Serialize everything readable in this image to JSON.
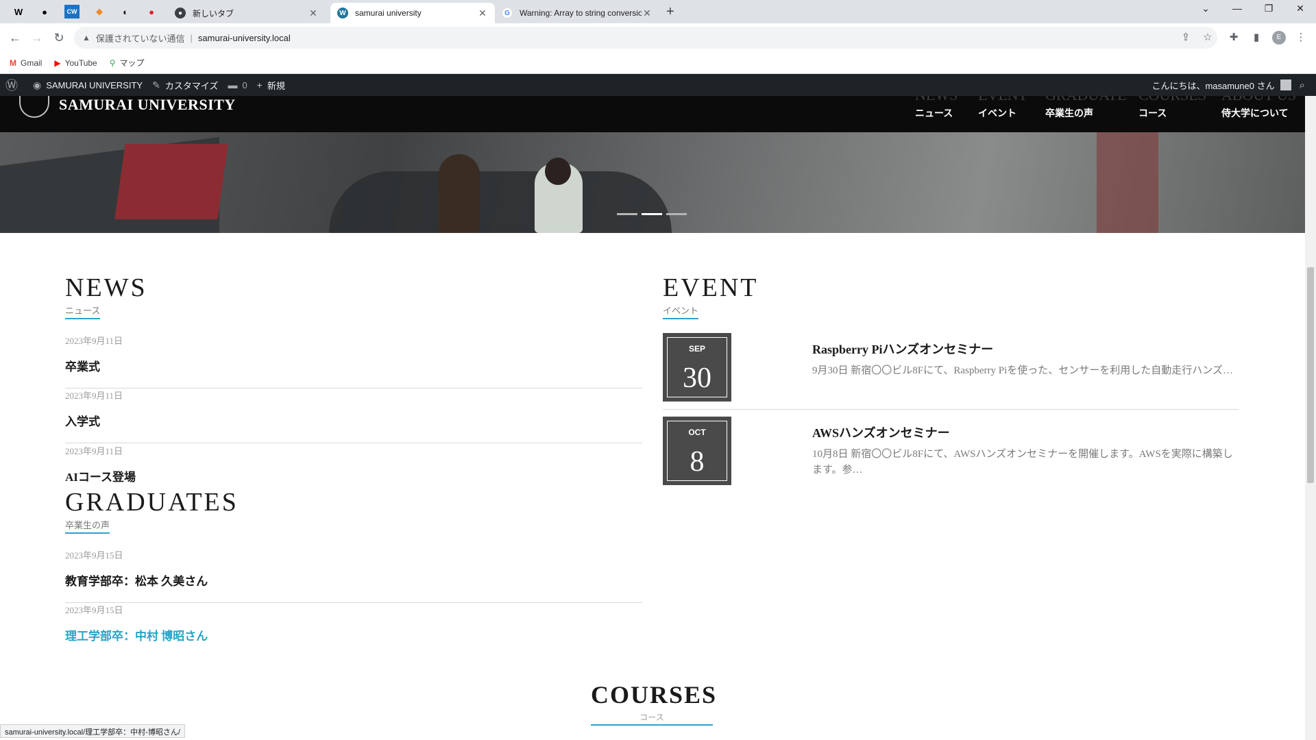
{
  "browser": {
    "tabs": [
      {
        "title": "新しいタブ",
        "favicon": "github-icon"
      },
      {
        "title": "samurai university",
        "favicon": "wordpress-icon",
        "active": true
      },
      {
        "title": "Warning: Array to string conversio",
        "favicon": "google-icon"
      }
    ],
    "address": {
      "security": "保護されていない通信",
      "url": "samurai-university.local"
    },
    "bookmarks": [
      {
        "label": "Gmail",
        "icon": "gmail-icon"
      },
      {
        "label": "YouTube",
        "icon": "youtube-icon"
      },
      {
        "label": "マップ",
        "icon": "maps-icon"
      }
    ],
    "profile_initial": "E",
    "status_url": "samurai-university.local/理工学部卒：中村-博昭さん/"
  },
  "adminbar": {
    "site_name": "SAMURAI UNIVERSITY",
    "customize": "カスタマイズ",
    "comments": "0",
    "new": "新規",
    "greeting": "こんにちは、masamune0 さん"
  },
  "site": {
    "name": "SAMURAI UNIVERSITY",
    "nav": [
      {
        "en": "NEWS",
        "jp": "ニュース"
      },
      {
        "en": "EVENT",
        "jp": "イベント"
      },
      {
        "en": "GRADUATE",
        "jp": "卒業生の声"
      },
      {
        "en": "COURSES",
        "jp": "コース"
      },
      {
        "en": "ABOUT US",
        "jp": "侍大学について"
      }
    ],
    "slider_active": 2
  },
  "news": {
    "title": "NEWS",
    "subtitle": "ニュース",
    "items": [
      {
        "date": "2023年9月11日",
        "title": "卒業式"
      },
      {
        "date": "2023年9月11日",
        "title": "入学式"
      },
      {
        "date": "2023年9月11日",
        "title": "AIコース登場"
      }
    ]
  },
  "graduates": {
    "title": "GRADUATES",
    "subtitle": "卒業生の声",
    "items": [
      {
        "date": "2023年9月15日",
        "title": "教育学部卒：松本 久美さん"
      },
      {
        "date": "2023年9月15日",
        "title": "理工学部卒：中村 博昭さん"
      }
    ]
  },
  "event": {
    "title": "EVENT",
    "subtitle": "イベント",
    "items": [
      {
        "month": "SEP",
        "day": "30",
        "title": "Raspberry Piハンズオンセミナー",
        "desc": "9月30日 新宿〇〇ビル8Fにて、Raspberry Piを使った、センサーを利用した自動走行ハンズ…"
      },
      {
        "month": "OCT",
        "day": "8",
        "title": "AWSハンズオンセミナー",
        "desc": "10月8日 新宿〇〇ビル8Fにて、AWSハンズオンセミナーを開催します。AWSを実際に構築します。参…"
      }
    ]
  },
  "courses": {
    "title": "COURSES",
    "subtitle": "コース"
  },
  "colors": {
    "accent": "#2aa3c8",
    "header": "#0b0b0b",
    "adminbar": "#1d2327"
  }
}
